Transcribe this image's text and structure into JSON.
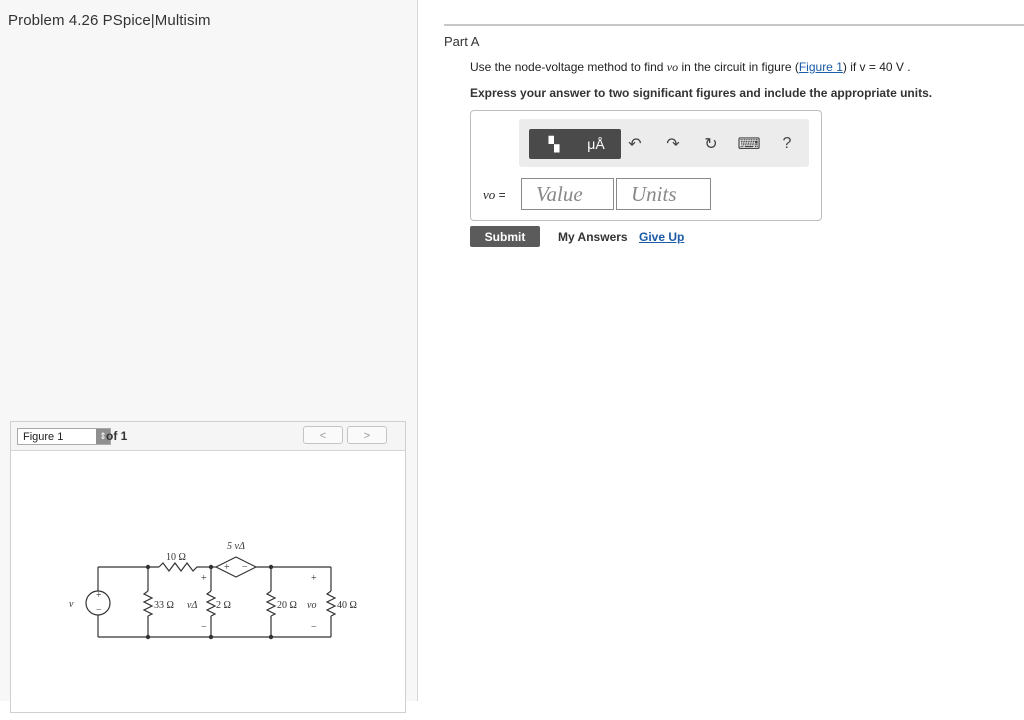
{
  "problem": {
    "title": "Problem 4.26 PSpice|Multisim"
  },
  "figure_panel": {
    "select_value": "Figure 1",
    "of_label": "of 1",
    "prev_label": "<",
    "next_label": ">"
  },
  "circuit": {
    "source_label": "v",
    "resistor_10": "10 Ω",
    "resistor_33": "33 Ω",
    "resistor_2": "2 Ω",
    "resistor_20": "20 Ω",
    "resistor_40": "40 Ω",
    "dependent_label": "5 vΔ",
    "v_delta": "vΔ",
    "v_o": "vo",
    "plus": "+",
    "minus": "−"
  },
  "part": {
    "title": "Part A",
    "question_pre": "Use the node-voltage method to find ",
    "question_var": "vo",
    "question_mid": " in the circuit in figure (",
    "question_link": "Figure 1",
    "question_post": ") if v = 40 V .",
    "instructions": "Express your answer to two significant figures and include the appropriate units."
  },
  "toolbar": {
    "template_label": "▚",
    "units_label": "μÅ",
    "undo_icon": "↶",
    "redo_icon": "↷",
    "reset_icon": "↻",
    "keyboard_icon": "⌨",
    "help_icon": "?"
  },
  "answer": {
    "label_var": "vo",
    "label_eq": " =",
    "value_placeholder": "Value",
    "units_placeholder": "Units"
  },
  "actions": {
    "submit_label": "Submit",
    "my_answers_label": "My Answers",
    "give_up_label": "Give Up"
  }
}
